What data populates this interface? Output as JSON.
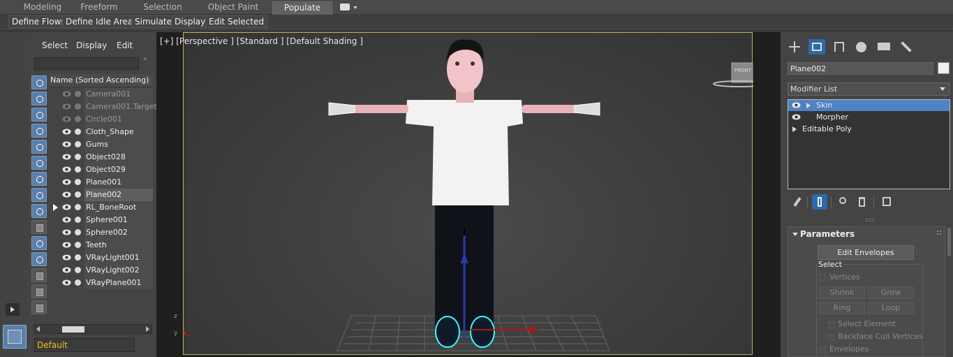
{
  "ribbon": {
    "tabs": [
      "Modeling",
      "Freeform",
      "Selection",
      "Object Paint",
      "Populate"
    ],
    "active_tab": "Populate",
    "tools": [
      "Define Flows",
      "Define Idle Areas",
      "Simulate",
      "Display",
      "Edit Selected"
    ]
  },
  "scene_explorer": {
    "menu": [
      "Select",
      "Display",
      "Edit"
    ],
    "header": "Name (Sorted Ascending)",
    "items": [
      {
        "name": "Camera001",
        "state": "dim"
      },
      {
        "name": "Camera001.Target",
        "state": "dim"
      },
      {
        "name": "Circle001",
        "state": "dim"
      },
      {
        "name": "Cloth_Shape",
        "state": "normal"
      },
      {
        "name": "Gums",
        "state": "normal"
      },
      {
        "name": "Object028",
        "state": "normal"
      },
      {
        "name": "Object029",
        "state": "normal"
      },
      {
        "name": "Plane001",
        "state": "normal"
      },
      {
        "name": "Plane002",
        "state": "selected"
      },
      {
        "name": "RL_BoneRoot",
        "state": "normal",
        "expandable": true
      },
      {
        "name": "Sphere001",
        "state": "normal"
      },
      {
        "name": "Sphere002",
        "state": "normal"
      },
      {
        "name": "Teeth",
        "state": "normal"
      },
      {
        "name": "VRayLight001",
        "state": "normal"
      },
      {
        "name": "VRayLight002",
        "state": "normal"
      },
      {
        "name": "VRayPlane001",
        "state": "normal"
      }
    ],
    "layer": "Default",
    "expand_glyph": "»"
  },
  "viewport": {
    "label": "[+] [Perspective ] [Standard ] [Default Shading ]",
    "viewcube_label": "FRONT",
    "axis_z": "z",
    "axis_x": "x",
    "axis_y": "y"
  },
  "command_panel": {
    "object_name": "Plane002",
    "modifier_list": "Modifier List",
    "stack": [
      {
        "label": "Skin",
        "selected": true
      },
      {
        "label": "Morpher",
        "selected": false
      },
      {
        "label": "Editable Poly",
        "selected": false
      }
    ],
    "rollout": {
      "title": "Parameters",
      "edit_envelopes": "Edit Envelopes",
      "select_group": "Select",
      "vertices": "Vertices",
      "shrink": "Shrink",
      "grow": "Grow",
      "ring": "Ring",
      "loop": "Loop",
      "select_element": "Select Element",
      "backface_cull": "Backface Cull Vertices",
      "envelopes": "Envelopes"
    }
  },
  "colors": {
    "accent": "#2c6aa8",
    "selection_yellow": "#c7b04a",
    "stack_selected": "#4e82c4",
    "layer_text": "#f0c020"
  }
}
